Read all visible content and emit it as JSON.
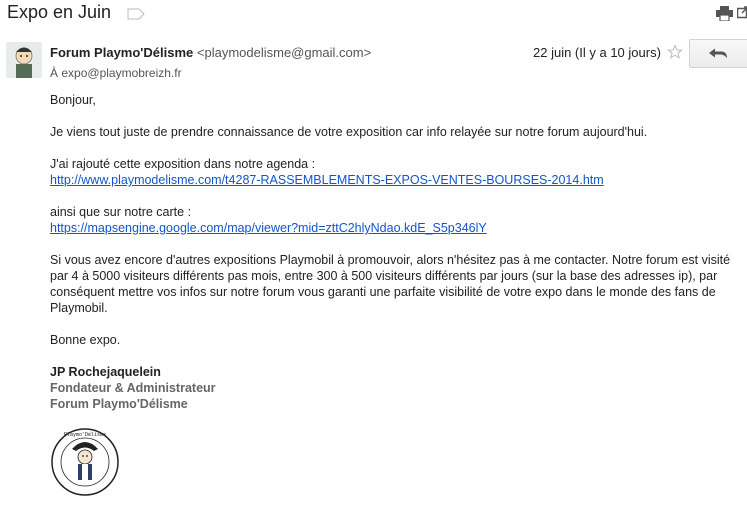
{
  "header": {
    "subject": "Expo en Juin"
  },
  "message": {
    "sender_name": "Forum Playmo'Délisme",
    "sender_email": "<playmodelisme@gmail.com>",
    "date": "22 juin (Il y a 10 jours)",
    "to_prefix": "À",
    "to_address": "expo@playmobreizh.fr"
  },
  "body": {
    "greeting": "Bonjour,",
    "p1": "Je viens tout juste de prendre connaissance de votre exposition car info relayée sur notre forum aujourd'hui.",
    "p2": "J'ai rajouté cette exposition dans notre agenda :",
    "link1": "http://www.playmodelisme.com/t4287-RASSEMBLEMENTS-EXPOS-VENTES-BOURSES-2014.htm",
    "p3": "ainsi que sur notre carte :",
    "link2": "https://mapsengine.google.com/map/viewer?mid=zttC2hlyNdao.kdE_S5p346lY",
    "p4": "Si vous avez encore d'autres expositions Playmobil à promouvoir, alors n'hésitez pas à me contacter. Notre forum est visité par 4 à 5000 visiteurs différents pas mois, entre 300 à 500 visiteurs différents par jours (sur la base des adresses ip), par conséquent mettre vos infos sur notre forum vous garanti une parfaite visibilité de votre expo dans le monde des fans de Playmobil.",
    "closing": "Bonne expo."
  },
  "signature": {
    "name": "JP Rochejaquelein",
    "title": "Fondateur & Administrateur",
    "org": "Forum Playmo'Délisme",
    "logo_text": "Playmo'Délisme"
  },
  "icons": {
    "label": "label-tag-icon",
    "print": "print-icon",
    "popout": "new-window-icon",
    "star": "star-icon",
    "reply": "reply-icon"
  },
  "colors": {
    "link": "#1155cc",
    "signature_grey": "#666666"
  }
}
